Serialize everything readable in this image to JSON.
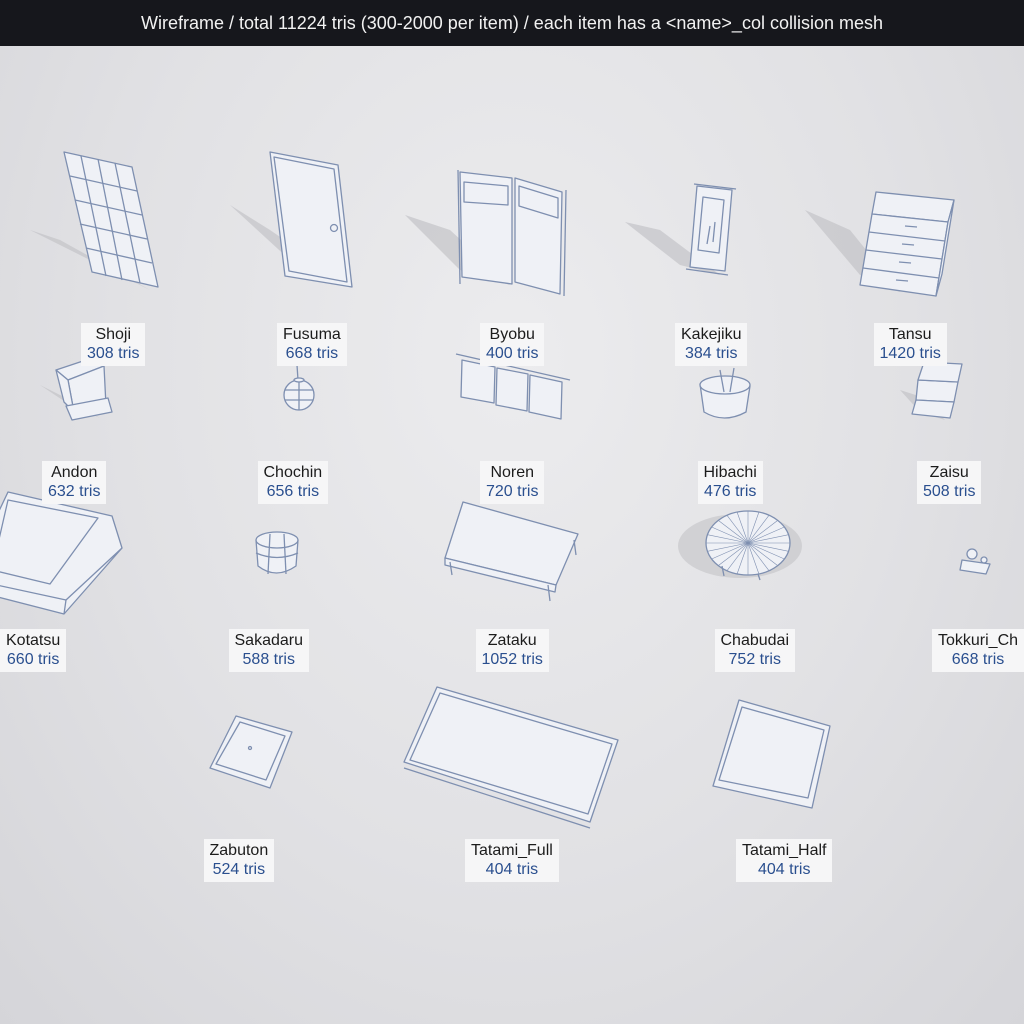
{
  "header": {
    "title": "Wireframe  /  total 11224 tris (300-2000 per item)  /  each item has a <name>_col collision mesh"
  },
  "colors": {
    "wire": "#7e8fb0",
    "fill": "#eff1f6",
    "shadow": "#bdbdc2",
    "tris_text": "#2a4f8f"
  },
  "items": [
    {
      "name": "Shoji",
      "tris": "308 tris",
      "icon": "shoji-screen-icon"
    },
    {
      "name": "Fusuma",
      "tris": "668 tris",
      "icon": "fusuma-door-icon"
    },
    {
      "name": "Byobu",
      "tris": "400 tris",
      "icon": "folding-screen-icon"
    },
    {
      "name": "Kakejiku",
      "tris": "384 tris",
      "icon": "hanging-scroll-icon"
    },
    {
      "name": "Tansu",
      "tris": "1420 tris",
      "icon": "chest-of-drawers-icon"
    },
    {
      "name": "Andon",
      "tris": "632 tris",
      "icon": "lantern-stand-icon"
    },
    {
      "name": "Chochin",
      "tris": "656 tris",
      "icon": "paper-lantern-icon"
    },
    {
      "name": "Noren",
      "tris": "720 tris",
      "icon": "curtain-icon"
    },
    {
      "name": "Hibachi",
      "tris": "476 tris",
      "icon": "brazier-icon"
    },
    {
      "name": "Zaisu",
      "tris": "508 tris",
      "icon": "legless-chair-icon"
    },
    {
      "name": "Kotatsu",
      "tris": "660 tris",
      "icon": "heated-table-icon"
    },
    {
      "name": "Sakadaru",
      "tris": "588 tris",
      "icon": "sake-barrel-icon"
    },
    {
      "name": "Zataku",
      "tris": "1052 tris",
      "icon": "low-table-icon"
    },
    {
      "name": "Chabudai",
      "tris": "752 tris",
      "icon": "round-table-icon"
    },
    {
      "name": "Tokkuri_Ch",
      "tris": "668 tris",
      "icon": "sake-set-icon"
    },
    {
      "name": "Zabuton",
      "tris": "524 tris",
      "icon": "cushion-icon"
    },
    {
      "name": "Tatami_Full",
      "tris": "404 tris",
      "icon": "tatami-full-icon"
    },
    {
      "name": "Tatami_Half",
      "tris": "404 tris",
      "icon": "tatami-half-icon"
    }
  ]
}
